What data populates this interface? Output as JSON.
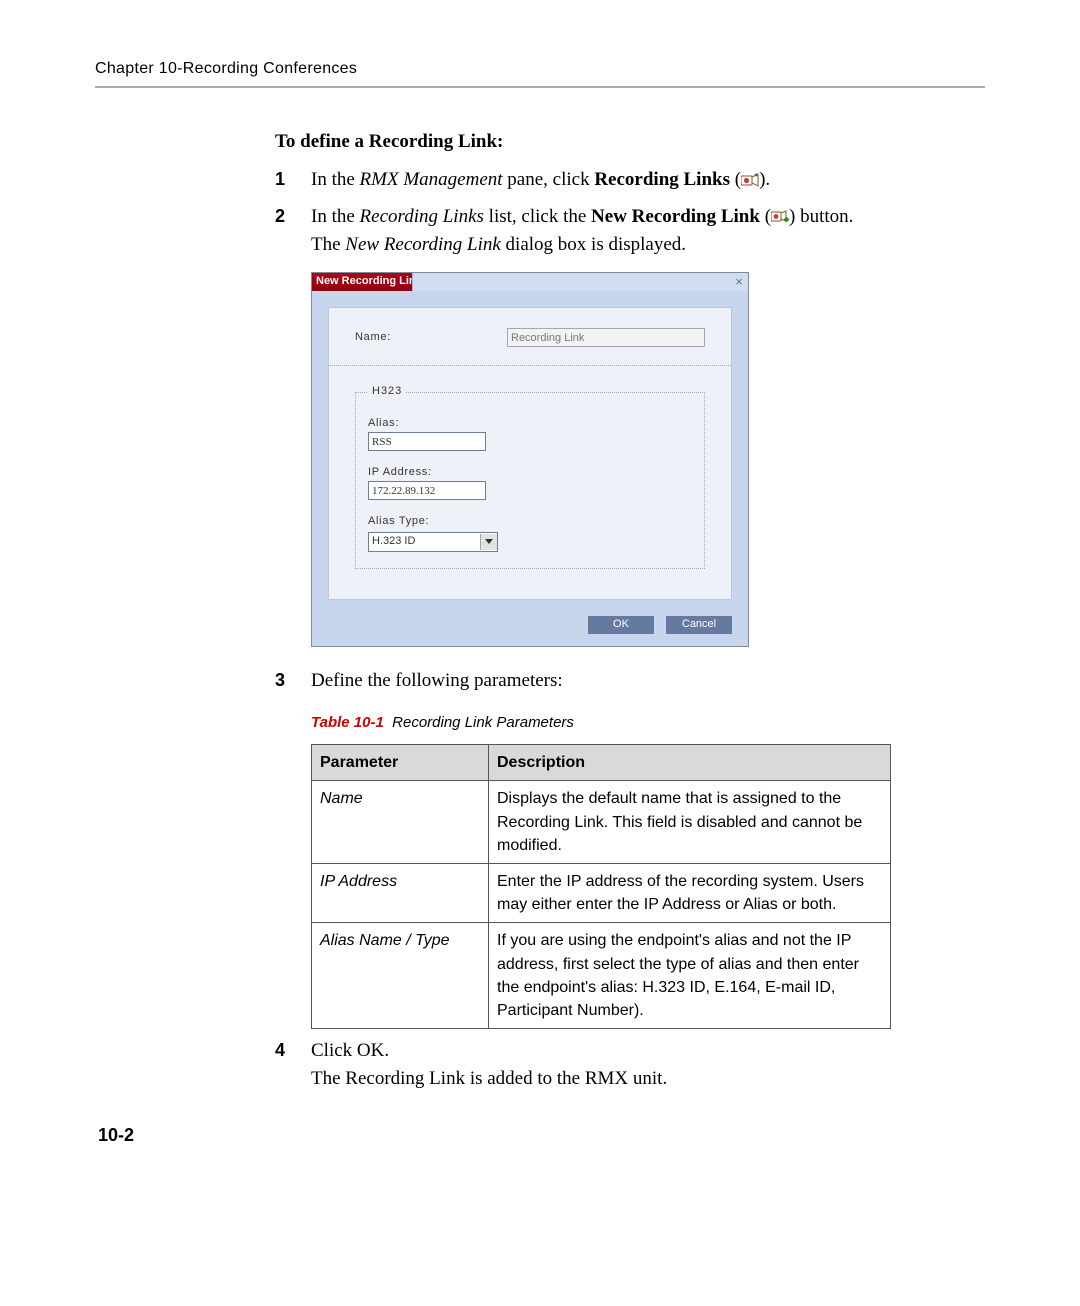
{
  "header": {
    "chapter": "Chapter 10-Recording Conferences"
  },
  "heading": "To define a Recording Link:",
  "steps": {
    "s1": {
      "num": "1",
      "pre": "In the ",
      "em1": "RMX Management",
      "mid": " pane, click ",
      "bold1": "Recording Links",
      "post": " (",
      "post2": ")."
    },
    "s2": {
      "num": "2",
      "pre": "In the ",
      "em1": "Recording Links",
      "mid": " list, click the ",
      "bold1": "New Recording Link",
      "post": " (",
      "post2": ") button.",
      "line2a": "The ",
      "line2em": "New Recording Link",
      "line2b": " dialog box is displayed."
    },
    "s3": {
      "num": "3",
      "text": "Define the following parameters:"
    },
    "s4": {
      "num": "4",
      "text": "Click OK.",
      "line2": "The Recording Link is added to the RMX unit."
    }
  },
  "dialog": {
    "title": "New Recording Link",
    "name_label": "Name:",
    "name_value": "Recording Link",
    "group": "H323",
    "alias_label": "Alias:",
    "alias_value": "RSS",
    "ip_label": "IP Address:",
    "ip_value": "172.22.89.132",
    "type_label": "Alias Type:",
    "type_value": "H.323 ID",
    "ok": "OK",
    "cancel": "Cancel"
  },
  "table": {
    "caption_num": "Table 10-1",
    "caption_title": "Recording Link Parameters",
    "head_param": "Parameter",
    "head_desc": "Description",
    "rows": [
      {
        "param": "Name",
        "desc": "Displays the default name that is assigned to the Recording Link. This field is disabled and cannot be modified."
      },
      {
        "param": "IP Address",
        "desc": "Enter the IP address of the recording system. Users may either enter the IP Address or Alias or both."
      },
      {
        "param": "Alias Name / Type",
        "desc": "If you are using the endpoint's alias and not the IP address, first select the type of alias and then enter the endpoint's alias: H.323 ID, E.164, E-mail ID, Participant Number)."
      }
    ]
  },
  "pagenum": "10-2"
}
